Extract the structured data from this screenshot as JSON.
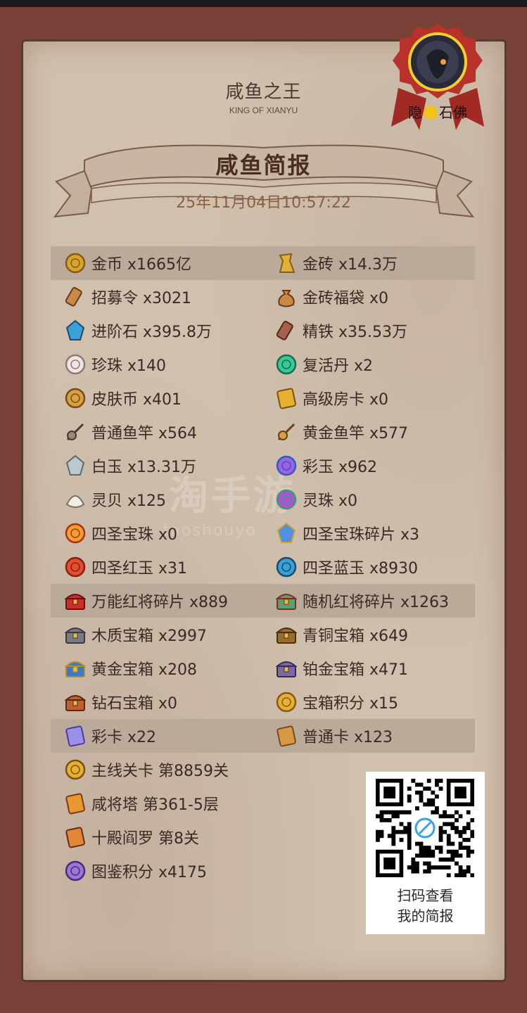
{
  "header": {
    "title_cn": "咸鱼之王",
    "title_en": "KING OF XIANYU",
    "banner_title": "咸鱼简报",
    "date": "25年11月04日10:57:22"
  },
  "player": {
    "name_left": "隐",
    "name_right": "石佛"
  },
  "watermark": {
    "text": "淘手游",
    "url_fragment": "taoshouyo"
  },
  "colors": {
    "frame": "#7a4236",
    "paper": "#d0c0ae",
    "highlight_row": "#b9aa9a",
    "date_text": "#8a6044",
    "seal_red": "#b8312a"
  },
  "rows": [
    {
      "highlight": true,
      "left": {
        "icon": "gold-coin-icon",
        "label": "金币 x1665亿"
      },
      "right": {
        "icon": "gold-brick-icon",
        "label": "金砖 x14.3万"
      }
    },
    {
      "highlight": false,
      "left": {
        "icon": "recruit-token-icon",
        "label": "招募令 x3021"
      },
      "right": {
        "icon": "lucky-bag-icon",
        "label": "金砖福袋 x0"
      }
    },
    {
      "highlight": false,
      "left": {
        "icon": "advance-stone-icon",
        "label": "进阶石 x395.8万"
      },
      "right": {
        "icon": "refined-iron-icon",
        "label": "精铁 x35.53万"
      }
    },
    {
      "highlight": false,
      "left": {
        "icon": "pearl-icon",
        "label": "珍珠 x140"
      },
      "right": {
        "icon": "revive-pill-icon",
        "label": "复活丹 x2"
      }
    },
    {
      "highlight": false,
      "left": {
        "icon": "skin-coin-icon",
        "label": "皮肤币 x401"
      },
      "right": {
        "icon": "room-card-icon",
        "label": "高级房卡 x0"
      }
    },
    {
      "highlight": false,
      "left": {
        "icon": "fishing-rod-icon",
        "label": "普通鱼竿 x564"
      },
      "right": {
        "icon": "golden-rod-icon",
        "label": "黄金鱼竿 x577"
      }
    },
    {
      "highlight": false,
      "left": {
        "icon": "white-jade-icon",
        "label": "白玉 x13.31万"
      },
      "right": {
        "icon": "rainbow-jade-icon",
        "label": "彩玉 x962"
      }
    },
    {
      "highlight": false,
      "left": {
        "icon": "spirit-shell-icon",
        "label": "灵贝 x125"
      },
      "right": {
        "icon": "spirit-pearl-icon",
        "label": "灵珠 x0"
      }
    },
    {
      "highlight": false,
      "left": {
        "icon": "holy-orb-icon",
        "label": "四圣宝珠 x0"
      },
      "right": {
        "icon": "orb-shard-icon",
        "label": "四圣宝珠碎片 x3"
      }
    },
    {
      "highlight": false,
      "left": {
        "icon": "red-jade-icon",
        "label": "四圣红玉 x31"
      },
      "right": {
        "icon": "blue-jade-icon",
        "label": "四圣蓝玉 x8930"
      }
    },
    {
      "highlight": true,
      "left": {
        "icon": "red-general-shard-icon",
        "label": "万能红将碎片 x889"
      },
      "right": {
        "icon": "random-shard-icon",
        "label": "随机红将碎片 x1263"
      }
    },
    {
      "highlight": false,
      "left": {
        "icon": "wood-chest-icon",
        "label": "木质宝箱 x2997"
      },
      "right": {
        "icon": "bronze-chest-icon",
        "label": "青铜宝箱 x649"
      }
    },
    {
      "highlight": false,
      "left": {
        "icon": "gold-chest-icon",
        "label": "黄金宝箱 x208"
      },
      "right": {
        "icon": "platinum-chest-icon",
        "label": "铂金宝箱 x471"
      }
    },
    {
      "highlight": false,
      "left": {
        "icon": "diamond-chest-icon",
        "label": "钻石宝箱 x0"
      },
      "right": {
        "icon": "chest-points-icon",
        "label": "宝箱积分 x15"
      }
    },
    {
      "highlight": true,
      "left": {
        "icon": "color-card-icon",
        "label": "彩卡 x22"
      },
      "right": {
        "icon": "normal-card-icon",
        "label": "普通卡 x123"
      }
    },
    {
      "highlight": false,
      "left": {
        "icon": "main-stage-icon",
        "label": "主线关卡 第8859关"
      },
      "right": null
    },
    {
      "highlight": false,
      "left": {
        "icon": "tower-icon",
        "label": "咸将塔 第361-5层"
      },
      "right": null
    },
    {
      "highlight": false,
      "left": {
        "icon": "yama-icon",
        "label": "十殿阎罗 第8关"
      },
      "right": null
    },
    {
      "highlight": false,
      "left": {
        "icon": "codex-icon",
        "label": "图鉴积分 x4175"
      },
      "right": null
    }
  ],
  "qr": {
    "caption_line1": "扫码查看",
    "caption_line2": "我的简报"
  }
}
